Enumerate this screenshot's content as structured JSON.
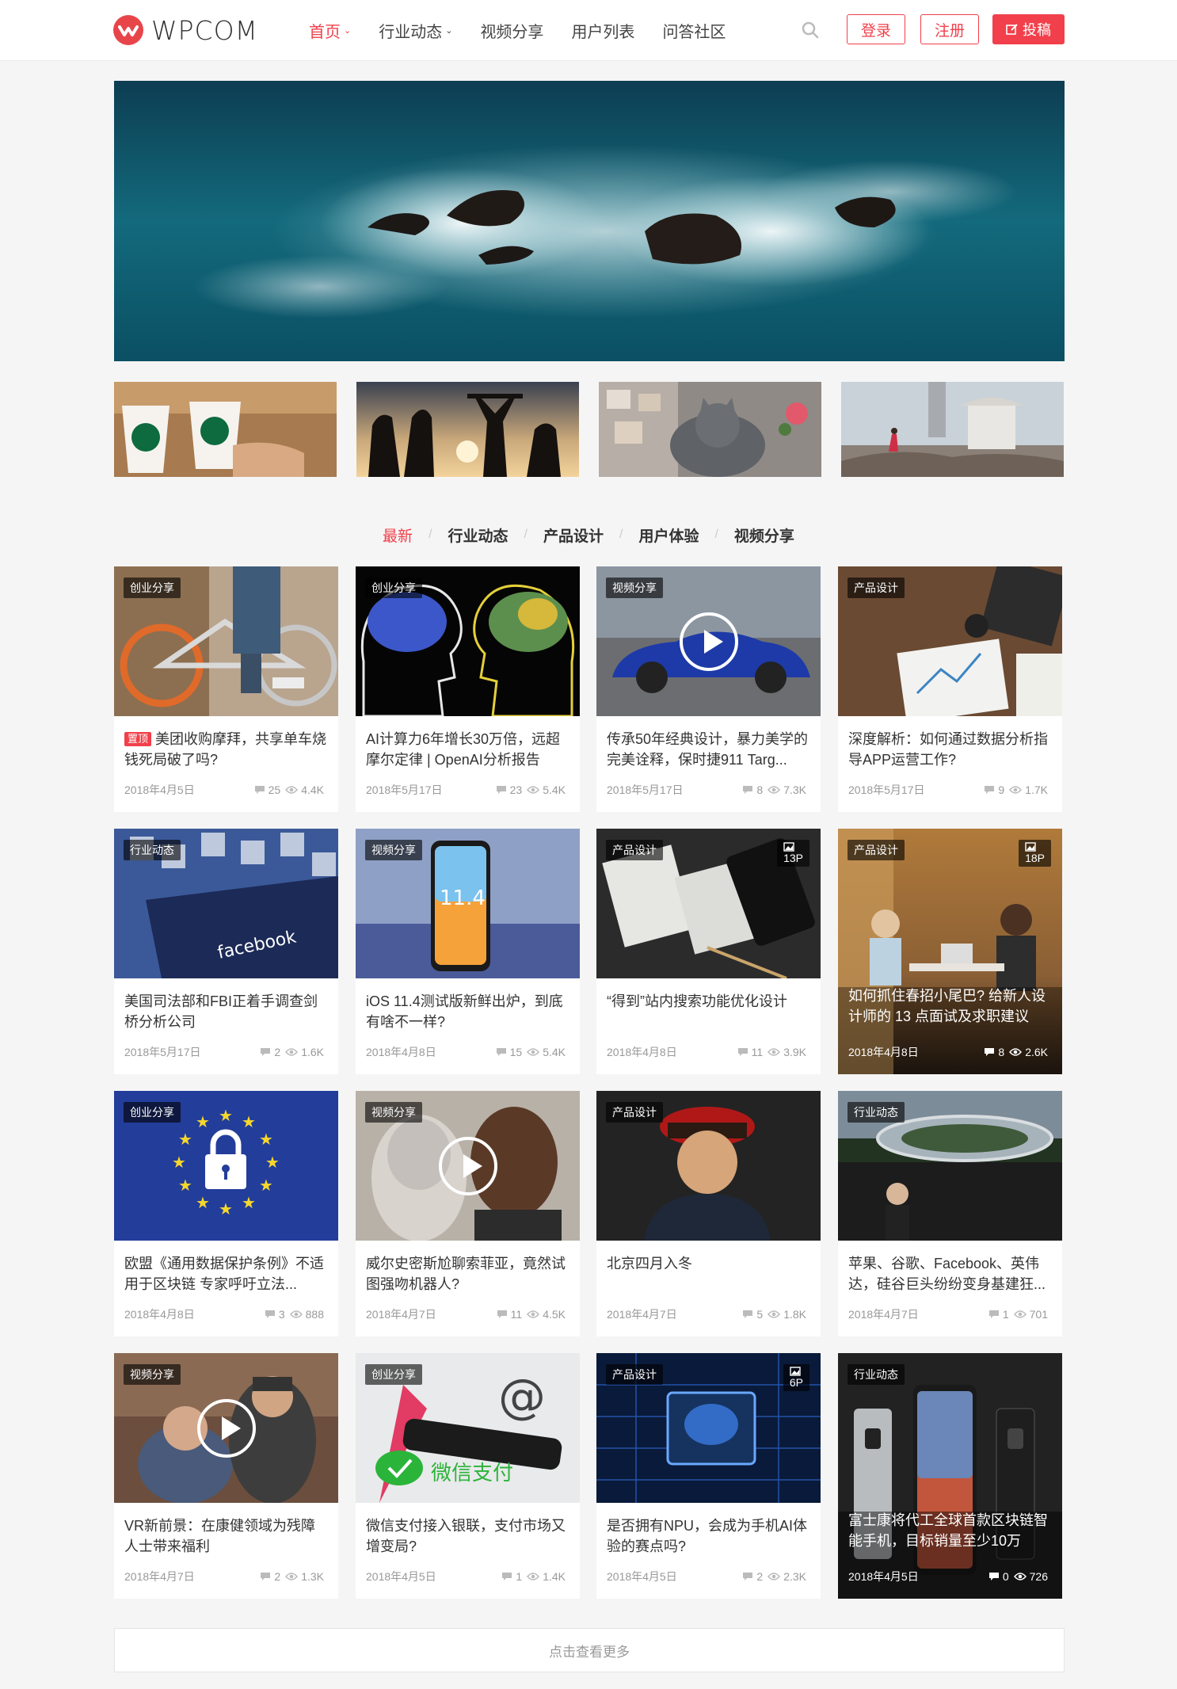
{
  "brand": {
    "name": "WPCOM",
    "accent": "#f1404b"
  },
  "nav": [
    {
      "label": "首页",
      "dropdown": true,
      "active": true
    },
    {
      "label": "行业动态",
      "dropdown": true
    },
    {
      "label": "视频分享"
    },
    {
      "label": "用户列表"
    },
    {
      "label": "问答社区"
    }
  ],
  "actions": {
    "login": "登录",
    "register": "注册",
    "submit": "投稿"
  },
  "tabs": [
    "最新",
    "行业动态",
    "产品设计",
    "用户体验",
    "视频分享"
  ],
  "posts": [
    {
      "cat": "创业分享",
      "pin": "置顶",
      "title": "美团收购摩拜，共享单车烧钱死局破了吗?",
      "date": "2018年4月5日",
      "comments": "25",
      "views": "4.4K"
    },
    {
      "cat": "创业分享",
      "title": "AI计算力6年增长30万倍，远超摩尔定律 | OpenAI分析报告",
      "date": "2018年5月17日",
      "comments": "23",
      "views": "5.4K"
    },
    {
      "cat": "视频分享",
      "title": "传承50年经典设计，暴力美学的完美诠释，保时捷911 Targ...",
      "date": "2018年5月17日",
      "comments": "8",
      "views": "7.3K"
    },
    {
      "cat": "产品设计",
      "title": "深度解析：如何通过数据分析指导APP运营工作?",
      "date": "2018年5月17日",
      "comments": "9",
      "views": "1.7K"
    },
    {
      "cat": "行业动态",
      "title": "美国司法部和FBI正着手调查剑桥分析公司",
      "date": "2018年5月17日",
      "comments": "2",
      "views": "1.6K"
    },
    {
      "cat": "视频分享",
      "title": "iOS 11.4测试版新鲜出炉，到底有啥不一样?",
      "date": "2018年4月8日",
      "comments": "15",
      "views": "5.4K"
    },
    {
      "cat": "产品设计",
      "pcount": "13P",
      "title": "“得到”站内搜索功能优化设计",
      "date": "2018年4月8日",
      "comments": "11",
      "views": "3.9K"
    },
    {
      "cat": "产品设计",
      "pcount": "18P",
      "title": "如何抓住春招小尾巴? 给新人设计师的 13 点面试及求职建议",
      "date": "2018年4月8日",
      "comments": "8",
      "views": "2.6K"
    },
    {
      "cat": "创业分享",
      "title": "欧盟《通用数据保护条例》不适用于区块链 专家呼吁立法...",
      "date": "2018年4月8日",
      "comments": "3",
      "views": "888"
    },
    {
      "cat": "视频分享",
      "title": "威尔史密斯尬聊索菲亚，竟然试图强吻机器人?",
      "date": "2018年4月7日",
      "comments": "11",
      "views": "4.5K"
    },
    {
      "cat": "产品设计",
      "title": "北京四月入冬",
      "date": "2018年4月7日",
      "comments": "5",
      "views": "1.8K"
    },
    {
      "cat": "行业动态",
      "title": "苹果、谷歌、Facebook、英伟达，硅谷巨头纷纷变身基建狂...",
      "date": "2018年4月7日",
      "comments": "1",
      "views": "701"
    },
    {
      "cat": "视频分享",
      "title": "VR新前景：在康健领域为残障人士带来福利",
      "date": "2018年4月7日",
      "comments": "2",
      "views": "1.3K"
    },
    {
      "cat": "创业分享",
      "title": "微信支付接入银联，支付市场又增变局?",
      "date": "2018年4月5日",
      "comments": "1",
      "views": "1.4K"
    },
    {
      "cat": "产品设计",
      "pcount": "6P",
      "title": "是否拥有NPU，会成为手机AI体验的赛点吗?",
      "date": "2018年4月5日",
      "comments": "2",
      "views": "2.3K"
    },
    {
      "cat": "行业动态",
      "title": "富士康将代工全球首款区块链智能手机，目标销量至少10万",
      "date": "2018年4月5日",
      "comments": "0",
      "views": "726"
    }
  ],
  "image_text": {
    "facebook": "facebook",
    "ios": "11.4",
    "wechat": "微信支付"
  },
  "load_more": "点击查看更多"
}
